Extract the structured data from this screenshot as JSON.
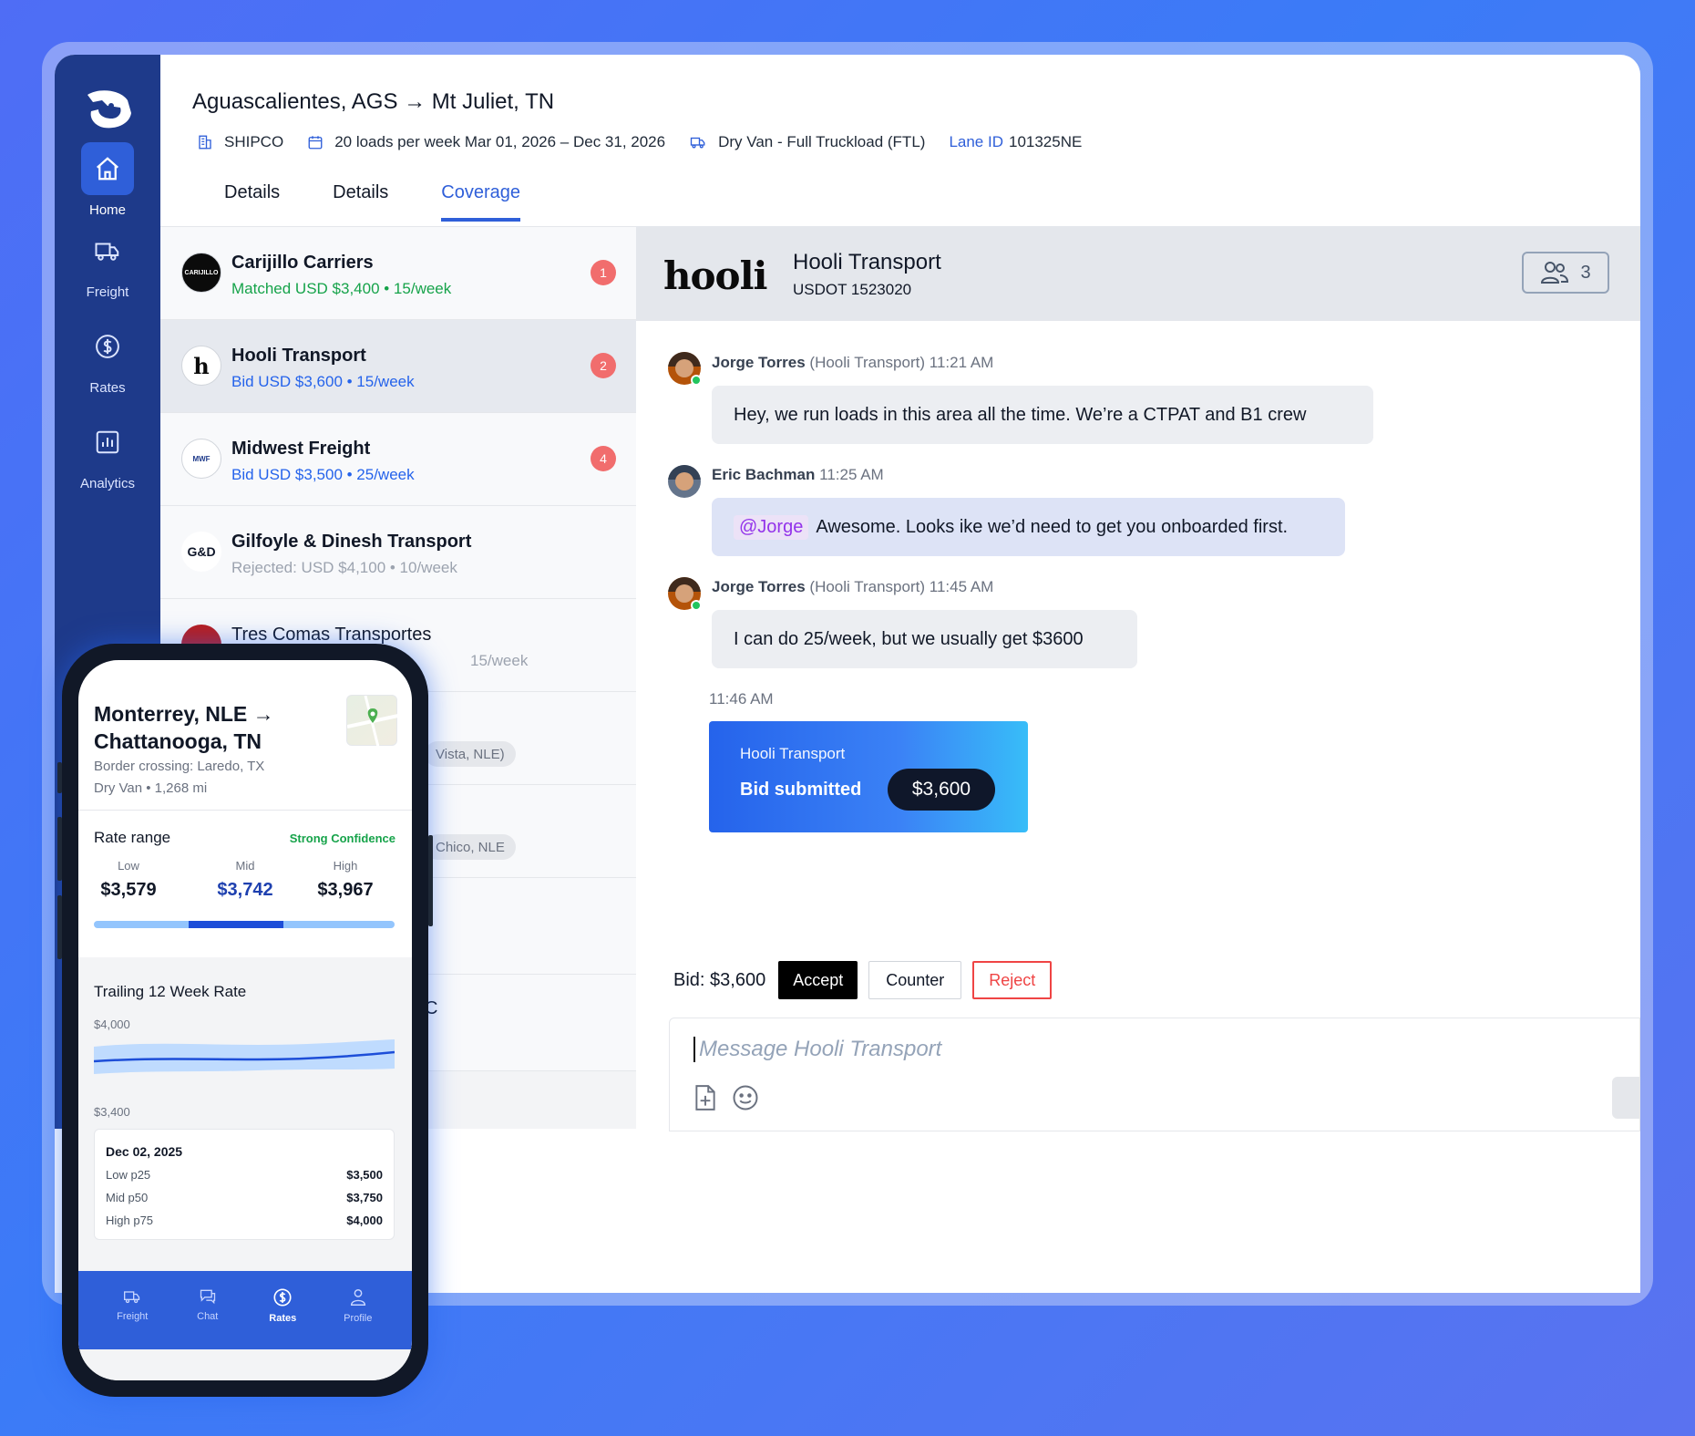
{
  "nav": [
    {
      "label": "Home",
      "icon": "home-icon",
      "active": true
    },
    {
      "label": "Freight",
      "icon": "truck-icon"
    },
    {
      "label": "Rates",
      "icon": "dollar-icon"
    },
    {
      "label": "Analytics",
      "icon": "chart-icon"
    }
  ],
  "lane": {
    "title": "Aguascalientes, AGS → Mt Juliet, TN",
    "shipper": "SHIPCO",
    "schedule": "20 loads per week Mar 01, 2026 – Dec 31, 2026",
    "equipment": "Dry Van - Full Truckload (FTL)",
    "lane_id_label": "Lane ID",
    "lane_id": "101325NE"
  },
  "tabs": [
    {
      "label": "Details"
    },
    {
      "label": "Details"
    },
    {
      "label": "Coverage",
      "active": true
    }
  ],
  "carriers": [
    {
      "name": "Carijillo Carriers",
      "sub": "Matched USD $3,400 • 15/week",
      "status": "green",
      "badge": "1",
      "avatar": "CARIJILLO"
    },
    {
      "name": "Hooli Transport",
      "sub": "Bid USD $3,600 • 15/week",
      "status": "blue",
      "badge": "2",
      "avatar": "h"
    },
    {
      "name": "Midwest Freight",
      "sub": "Bid USD $3,500 • 25/week",
      "status": "blue",
      "badge": "4",
      "avatar": "MWF"
    },
    {
      "name": "Gilfoyle & Dinesh Transport",
      "sub": "Rejected: USD $4,100 • 10/week",
      "status": "gray",
      "badge": "",
      "avatar": "G&D"
    },
    {
      "name": "Tres Comas Transportes",
      "sub": "15/week",
      "status": "gray",
      "badge": "",
      "avatar": "TCT"
    }
  ],
  "list_fragments": {
    "chip1": "Vista, NLE)",
    "chip2": "Chico, NLE",
    "tail": "C"
  },
  "chat": {
    "logo": "hooli",
    "name": "Hooli Transport",
    "usdot": "USDOT 1523020",
    "members": "3",
    "messages": [
      {
        "author": "Jorge Torres",
        "org": "(Hooli Transport)",
        "time": "11:21 AM",
        "text": "Hey, we run loads in this area all the time. We’re a CTPAT and B1 crew"
      },
      {
        "author": "Eric Bachman",
        "org": "",
        "time": "11:25 AM",
        "mention": "@Jorge",
        "text": "Awesome. Looks ike we’d need to get you onboarded first."
      },
      {
        "author": "Jorge Torres",
        "org": "(Hooli Transport)",
        "time": "11:45 AM",
        "text": "I can do 25/week, but we usually get $3600"
      }
    ],
    "bid_time": "11:46 AM",
    "bid_card": {
      "company": "Hooli Transport",
      "status": "Bid submitted",
      "amount": "$3,600"
    },
    "bid_label": "Bid: $3,600",
    "accept": "Accept",
    "counter": "Counter",
    "reject": "Reject",
    "placeholder": "Message Hooli Transport"
  },
  "mobile": {
    "route": "Monterrey, NLE → Chattanooga, TN",
    "border": "Border crossing: Laredo, TX",
    "van": "Dry Van • 1,268 mi",
    "rate_range": "Rate range",
    "confidence": "Strong Confidence",
    "low_label": "Low",
    "low": "$3,579",
    "mid_label": "Mid",
    "mid": "$3,742",
    "high_label": "High",
    "high": "$3,967",
    "range_mid_start": 0.315,
    "range_mid_end": 0.63,
    "trailing": "Trailing 12 Week Rate",
    "y_top": "$4,000",
    "y_bottom": "$3,400",
    "tip": {
      "date": "Dec 02, 2025",
      "rows": [
        {
          "label": "Low p25",
          "value": "$3,500"
        },
        {
          "label": "Mid p50",
          "value": "$3,750"
        },
        {
          "label": "High p75",
          "value": "$4,000"
        }
      ]
    },
    "tabs": [
      {
        "label": "Freight"
      },
      {
        "label": "Chat"
      },
      {
        "label": "Rates",
        "active": true
      },
      {
        "label": "Profile"
      }
    ]
  },
  "colors": {
    "brand": "#1e3a8a",
    "accent": "#2f5fd9",
    "matched": "#16a34a",
    "bid": "#2563eb",
    "badge": "#f16d6d"
  }
}
